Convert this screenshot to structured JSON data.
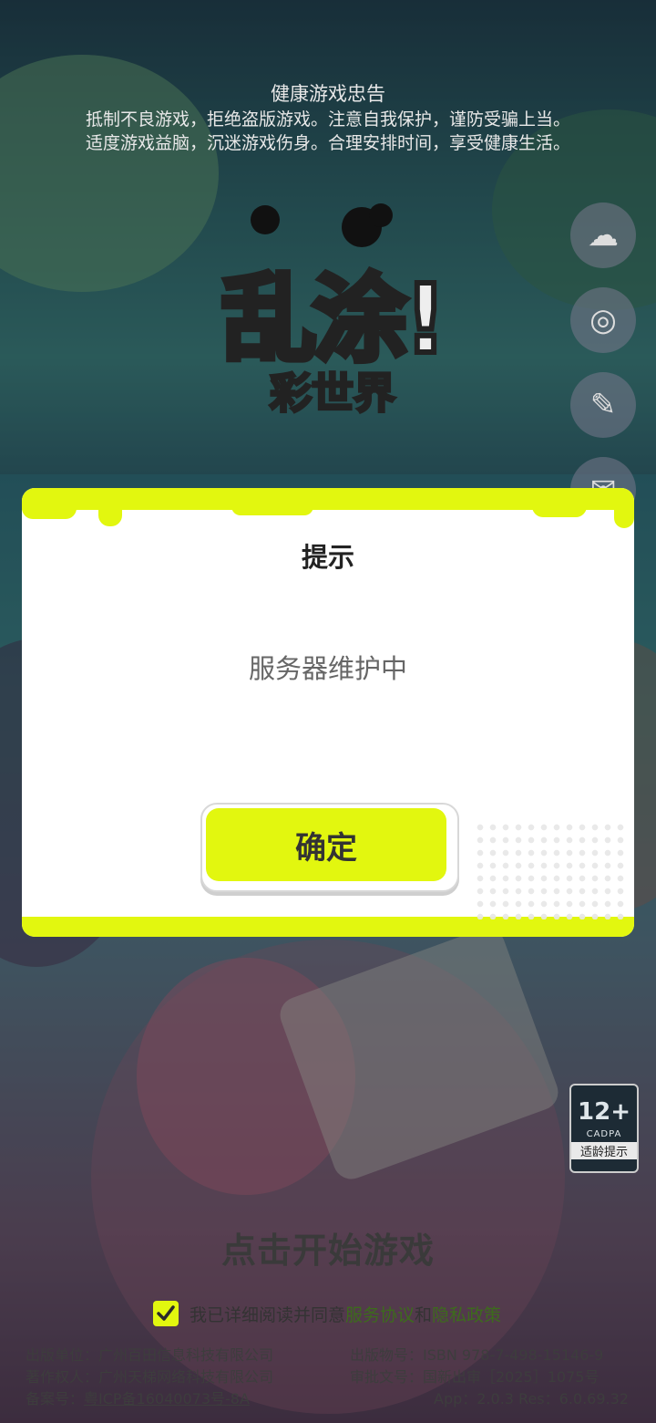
{
  "notice": {
    "title": "健康游戏忠告",
    "line1": "抵制不良游戏，拒绝盗版游戏。注意自我保护，谨防受骗上当。",
    "line2": "适度游戏益脑，沉迷游戏伤身。合理安排时间，享受健康生活。"
  },
  "logo": {
    "main": "乱涂!",
    "sub": "彩世界"
  },
  "dialog": {
    "title": "提示",
    "message": "服务器维护中",
    "confirm_label": "确定"
  },
  "start_text": "点击开始游戏",
  "age_rating": {
    "age": "12+",
    "org": "CADPA",
    "tip": "适龄提示"
  },
  "agreement": {
    "prefix": "我已详细阅读并同意",
    "service_link": "服务协议",
    "joiner": "和",
    "privacy_link": "隐私政策",
    "checked": true
  },
  "footer": {
    "publisher": "出版单位：广州百田信息科技有限公司",
    "copyright": "著作权人：广州天梯网络科技有限公司",
    "icp_label": "备案号：",
    "icp_value": "粤ICP备16040073号-8A",
    "isbn": "出版物号：ISBN 978-7-498-15146-9",
    "approval": "审批文号：国新出审［2025］1075号",
    "version": "App：2.0.3 Res：6.0.69.32"
  },
  "colors": {
    "accent": "#e2f70f",
    "link": "#3d6b1c"
  }
}
